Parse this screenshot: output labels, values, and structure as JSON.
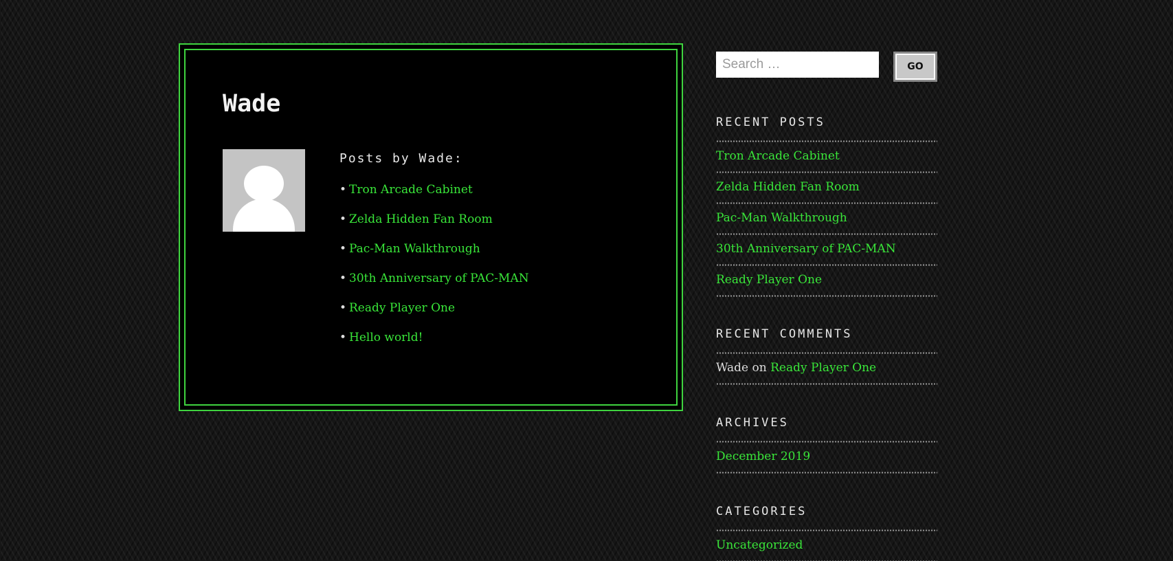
{
  "author": {
    "name": "Wade",
    "posts_heading": "Posts by Wade:",
    "posts": [
      "Tron Arcade Cabinet",
      "Zelda Hidden Fan Room",
      "Pac-Man Walkthrough",
      "30th Anniversary of PAC-MAN",
      "Ready Player One",
      "Hello world!"
    ]
  },
  "search": {
    "placeholder": "Search …",
    "button_label": "GO"
  },
  "sidebar": {
    "recent_posts": {
      "title": "RECENT POSTS",
      "items": [
        "Tron Arcade Cabinet",
        "Zelda Hidden Fan Room",
        "Pac-Man Walkthrough",
        "30th Anniversary of PAC-MAN",
        "Ready Player One"
      ]
    },
    "recent_comments": {
      "title": "RECENT COMMENTS",
      "items": [
        {
          "author": "Wade",
          "on": "on",
          "post": "Ready Player One"
        }
      ]
    },
    "archives": {
      "title": "ARCHIVES",
      "items": [
        "December 2019"
      ]
    },
    "categories": {
      "title": "CATEGORIES",
      "items": [
        "Uncategorized"
      ]
    }
  },
  "colors": {
    "link": "#39e639",
    "frame": "#3fd43f",
    "panel": "#000000"
  }
}
